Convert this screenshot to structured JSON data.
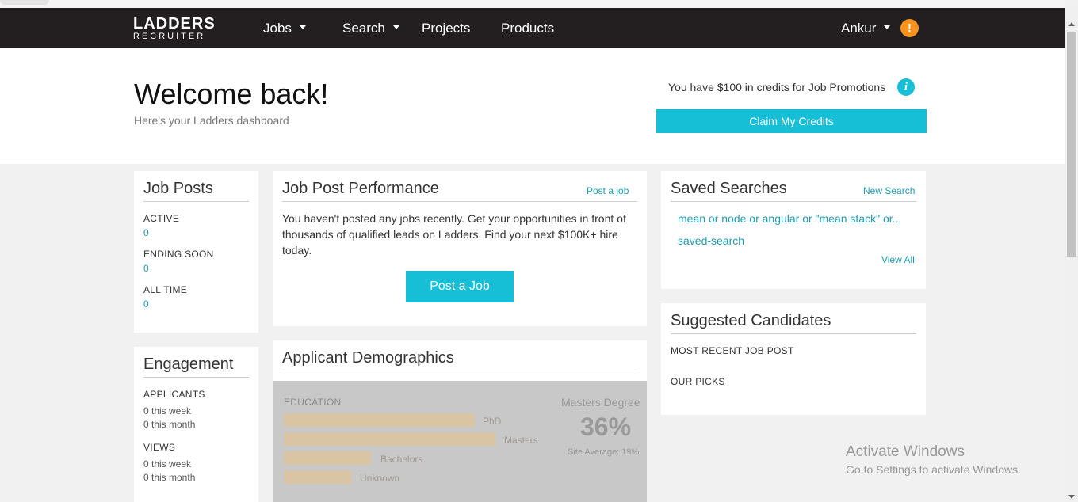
{
  "nav": {
    "logo_line1": "LADDERS",
    "logo_line2": "RECRUITER",
    "items": [
      {
        "label": "Jobs"
      },
      {
        "label": "Search"
      },
      {
        "label": "Projects"
      },
      {
        "label": "Products"
      }
    ],
    "user": "Ankur",
    "alert_glyph": "!"
  },
  "hero": {
    "title": "Welcome back!",
    "subtitle": "Here's your Ladders dashboard",
    "credits_text": "You have $100 in credits for Job Promotions",
    "info_glyph": "i",
    "claim_button": "Claim My Credits"
  },
  "job_posts": {
    "title": "Job Posts",
    "active_label": "ACTIVE",
    "active_value": "0",
    "ending_label": "ENDING SOON",
    "ending_value": "0",
    "alltime_label": "ALL TIME",
    "alltime_value": "0"
  },
  "engagement": {
    "title": "Engagement",
    "applicants_label": "APPLICANTS",
    "applicants_week": "0 this week",
    "applicants_month": "0 this month",
    "views_label": "VIEWS",
    "views_week": "0 this week",
    "views_month": "0 this month"
  },
  "performance": {
    "title": "Job Post Performance",
    "post_link": "Post a job",
    "body": "You haven't posted any jobs recently. Get your opportunities in front of thousands of qualified leads on Ladders. Find your next $100K+ hire today.",
    "post_button": "Post a Job"
  },
  "demographics": {
    "title": "Applicant Demographics",
    "education_label": "EDUCATION",
    "bars": [
      {
        "label": "PhD"
      },
      {
        "label": "Masters"
      },
      {
        "label": "Bachelors"
      },
      {
        "label": "Unknown"
      }
    ],
    "highlight_label": "Masters Degree",
    "highlight_value": "36%",
    "site_average": "Site Average: 19%"
  },
  "saved_searches": {
    "title": "Saved Searches",
    "new_link": "New Search",
    "items": [
      {
        "label": "mean or node or angular or \"mean stack\" or..."
      },
      {
        "label": "saved-search"
      }
    ],
    "view_all": "View All"
  },
  "suggested": {
    "title": "Suggested Candidates",
    "recent_label": "MOST RECENT JOB POST",
    "picks_label": "OUR PICKS"
  },
  "watermark": {
    "line1": "Activate Windows",
    "line2": "Go to Settings to activate Windows."
  },
  "colors": {
    "accent": "#17bfd6",
    "nav_bg": "#231f20",
    "link": "#1e9db3",
    "alert": "#f7931e"
  }
}
